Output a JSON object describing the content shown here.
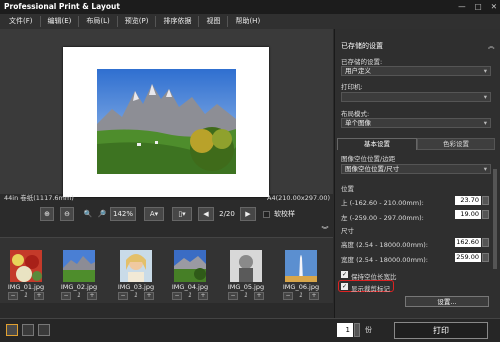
{
  "app": {
    "title": "Professional Print & Layout",
    "win_min": "—",
    "win_max": "□",
    "win_close": "✕"
  },
  "menu": [
    "文件(F)",
    "编辑(E)",
    "布局(L)",
    "预览(P)",
    "排序依据",
    "视图",
    "帮助(H)"
  ],
  "info": {
    "paper": "44in 卷纸(1117.6mm)",
    "size": "A4(210.00x297.00)"
  },
  "toolbar": {
    "zoom": "142%",
    "page": "2/20",
    "softproof": "软校样",
    "collapse": "︾"
  },
  "thumbs": [
    {
      "name": "IMG_01.jpg",
      "count": "1",
      "minus": "−",
      "plus": "+"
    },
    {
      "name": "IMG_02.jpg",
      "count": "1",
      "minus": "−",
      "plus": "+"
    },
    {
      "name": "IMG_03.jpg",
      "count": "1",
      "minus": "−",
      "plus": "+"
    },
    {
      "name": "IMG_04.jpg",
      "count": "1",
      "minus": "−",
      "plus": "+"
    },
    {
      "name": "IMG_05.jpg",
      "count": "1",
      "minus": "−",
      "plus": "+"
    },
    {
      "name": "IMG_06.jpg",
      "count": "1",
      "minus": "−",
      "plus": "+"
    }
  ],
  "bottom": {
    "copies": "1",
    "copies_unit": "份",
    "print": "打印"
  },
  "panel": {
    "saved_header": "已存储的设置",
    "collapse": "︽",
    "saved_label": "已存储的设置:",
    "saved_value": "用户定义",
    "printer_label": "打印机:",
    "printer_value": "",
    "layout_label": "布局模式:",
    "layout_value": "单个图像",
    "tab_basic": "基本设置",
    "tab_color": "色彩设置",
    "pos_label": "图像空位位置/边距",
    "pos_value": "图像空位位置/尺寸",
    "position": "位置",
    "up_label": "上 (-162.60 - 210.00mm):",
    "up_value": "23.70",
    "left_label": "左 (-259.00 - 297.00mm):",
    "left_value": "19.00",
    "size": "尺寸",
    "h_label": "高度 (2.54 - 18000.00mm):",
    "h_value": "162.60",
    "w_label": "宽度 (2.54 - 18000.00mm):",
    "w_value": "259.00",
    "keep_ratio": "保持空位长宽比",
    "show_crop": "显示裁剪标记",
    "settings_btn": "设置..."
  }
}
